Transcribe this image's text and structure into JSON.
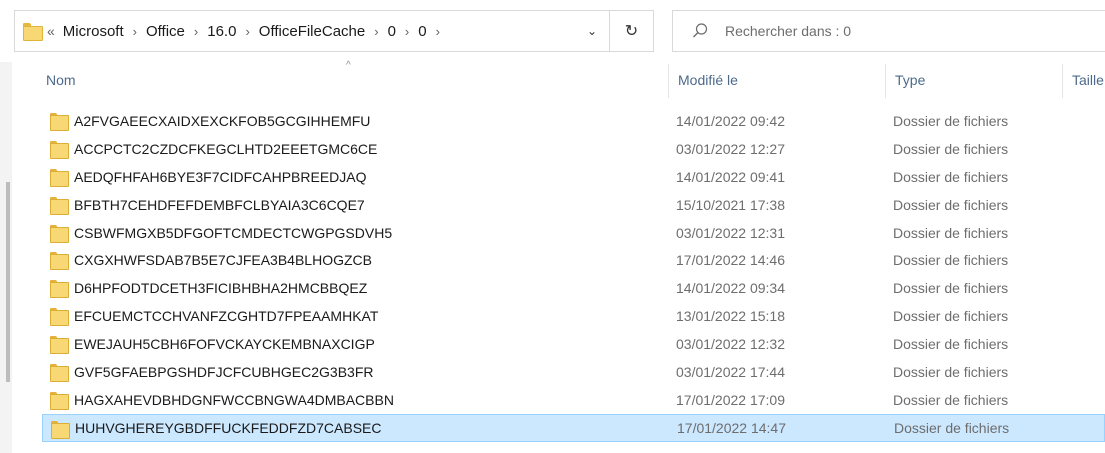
{
  "address_bar": {
    "overflow": "«",
    "separator": "›",
    "crumbs": [
      "Microsoft",
      "Office",
      "16.0",
      "OfficeFileCache",
      "0",
      "0"
    ],
    "dropdown_glyph": "⌄",
    "refresh_glyph": "↻"
  },
  "search": {
    "placeholder": "Rechercher dans : 0"
  },
  "columns": {
    "name": "Nom",
    "modified": "Modifié le",
    "type": "Type",
    "size": "Taille",
    "sort_glyph": "^"
  },
  "colors": {
    "selected_row": "#cce8ff",
    "selected_border": "#99d1ff",
    "header_text": "#4d6a8a",
    "folder": "#f8d775"
  },
  "rows": [
    {
      "name": "A2FVGAEECXAIDXEXCKFOB5GCGIHHEMFU",
      "modified": "14/01/2022 09:42",
      "type": "Dossier de fichiers",
      "icon": "folder-icon"
    },
    {
      "name": "ACCPCTC2CZDCFKEGCLHTD2EEETGMC6CE",
      "modified": "03/01/2022 12:27",
      "type": "Dossier de fichiers",
      "icon": "folder-icon"
    },
    {
      "name": "AEDQFHFAH6BYE3F7CIDFCAHPBREEDJAQ",
      "modified": "14/01/2022 09:41",
      "type": "Dossier de fichiers",
      "icon": "folder-icon"
    },
    {
      "name": "BFBTH7CEHDFEFDEMBFCLBYAIA3C6CQE7",
      "modified": "15/10/2021 17:38",
      "type": "Dossier de fichiers",
      "icon": "folder-icon"
    },
    {
      "name": "CSBWFMGXB5DFGOFTCMDECTCWGPGSDVH5",
      "modified": "03/01/2022 12:31",
      "type": "Dossier de fichiers",
      "icon": "folder-icon"
    },
    {
      "name": "CXGXHWFSDAB7B5E7CJFEA3B4BLHOGZCB",
      "modified": "17/01/2022 14:46",
      "type": "Dossier de fichiers",
      "icon": "folder-icon"
    },
    {
      "name": "D6HPFODTDCETH3FICIBHBHA2HMCBBQEZ",
      "modified": "14/01/2022 09:34",
      "type": "Dossier de fichiers",
      "icon": "folder-icon"
    },
    {
      "name": "EFCUEMCTCCHVANFZCGHTD7FPEAAMHKAT",
      "modified": "13/01/2022 15:18",
      "type": "Dossier de fichiers",
      "icon": "folder-icon"
    },
    {
      "name": "EWEJAUH5CBH6FOFVCKAYCKEMBNAXCIGP",
      "modified": "03/01/2022 12:32",
      "type": "Dossier de fichiers",
      "icon": "folder-icon"
    },
    {
      "name": "GVF5GFAEBPGSHDFJCFCUBHGEC2G3B3FR",
      "modified": "03/01/2022 17:44",
      "type": "Dossier de fichiers",
      "icon": "folder-icon"
    },
    {
      "name": "HAGXAHEVDBHDGNFWCCBNGWA4DMBACBBN",
      "modified": "17/01/2022 17:09",
      "type": "Dossier de fichiers",
      "icon": "folder-icon"
    },
    {
      "name": "HUHVGHEREYGBDFFUCKFEDDFZD7CABSEC",
      "modified": "17/01/2022 14:47",
      "type": "Dossier de fichiers",
      "icon": "folder-icon",
      "selected": true
    }
  ]
}
